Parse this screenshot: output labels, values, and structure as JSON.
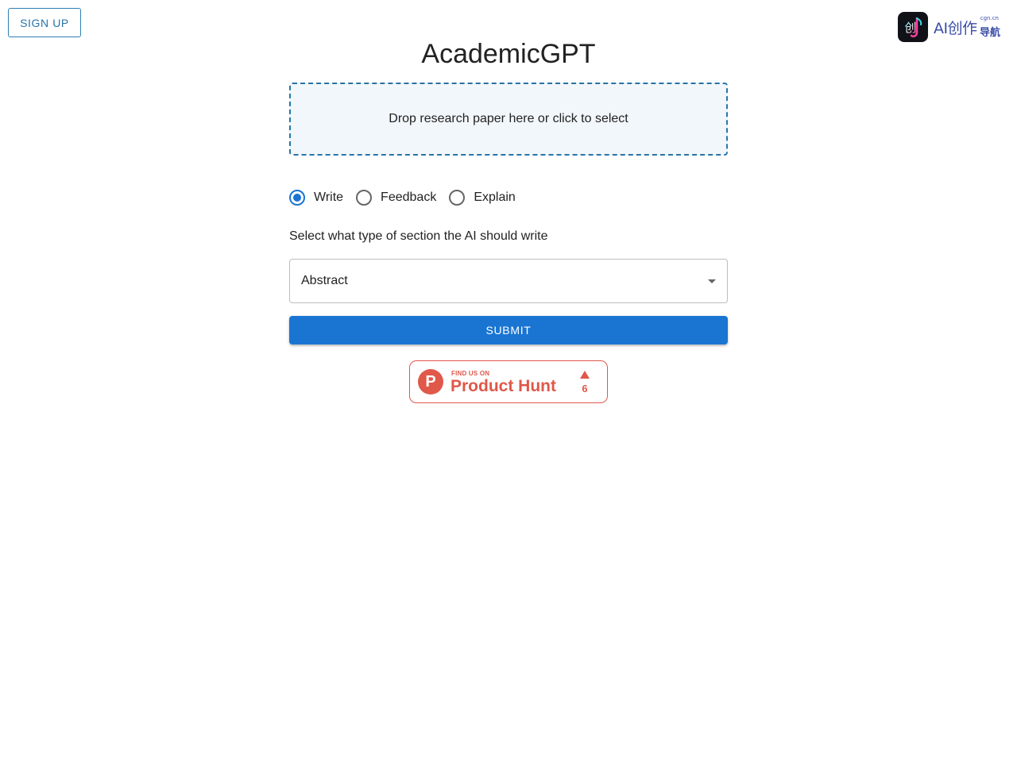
{
  "header": {
    "signup_label": "SIGN UP",
    "brand": {
      "logo_glyph": "创",
      "main_text": "AI创作",
      "sub_text": "导航",
      "domain_text": "cgn.cn"
    }
  },
  "main": {
    "title": "AcademicGPT",
    "dropzone_text": "Drop research paper here or click to select",
    "modes": [
      {
        "label": "Write",
        "checked": true
      },
      {
        "label": "Feedback",
        "checked": false
      },
      {
        "label": "Explain",
        "checked": false
      }
    ],
    "section_help": "Select what type of section the AI should write",
    "section_select_value": "Abstract",
    "submit_label": "SUBMIT"
  },
  "product_hunt": {
    "find_text": "FIND US ON",
    "name": "Product Hunt",
    "logo_letter": "P",
    "upvotes": "6"
  },
  "colors": {
    "accent": "#1a75d2",
    "outline": "#2a74a8",
    "product_hunt": "#e0584a",
    "brand_text": "#3b4ea8"
  }
}
